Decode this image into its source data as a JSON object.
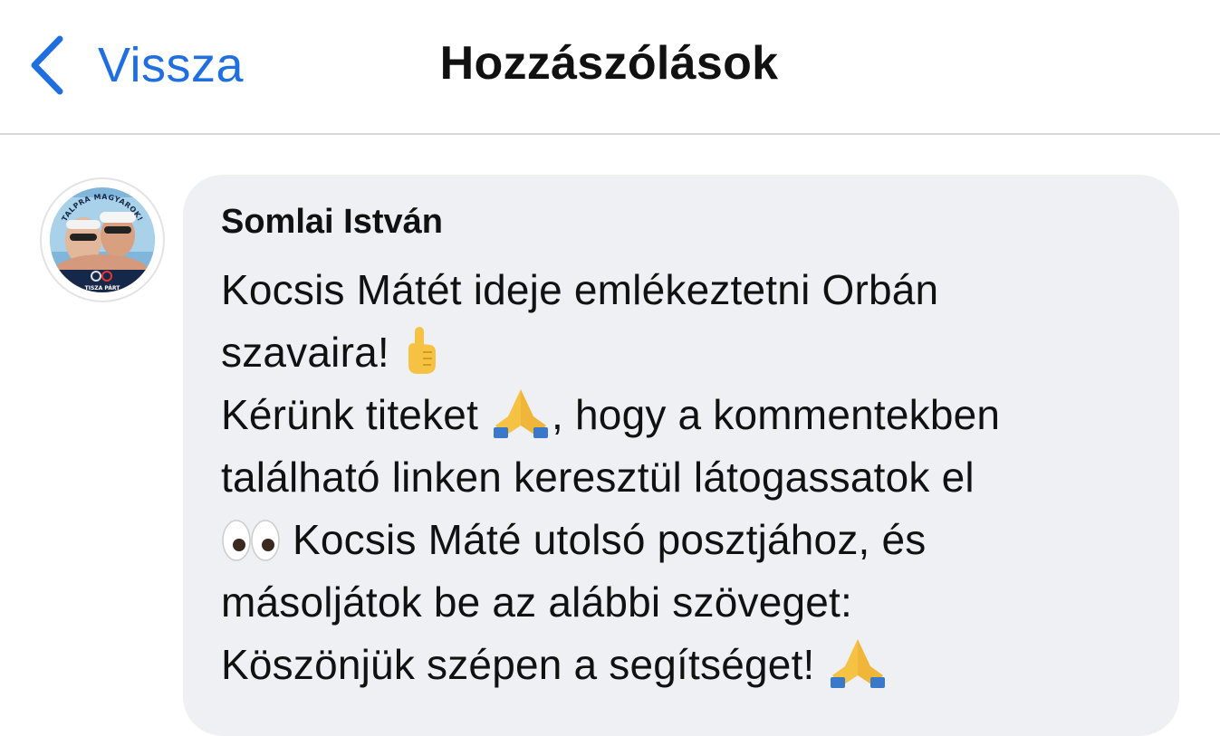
{
  "nav": {
    "back_label": "Vissza",
    "title": "Hozzászólások",
    "back_icon": "chevron-left-icon",
    "accent": "#1f6fe0"
  },
  "comment": {
    "author": "Somlai István",
    "avatar_text": {
      "top": "TALPRA MAGYAROK!",
      "bottom": "TISZA PÁRT"
    },
    "lines": [
      "Kocsis Mátét ideje emlékeztetni Orbán",
      "szavaira! ",
      "Kérünk titeket ",
      ", hogy a kommentekben",
      "található linken keresztül látogassatok el",
      " Kocsis Máté utolsó posztjához, és",
      "másoljátok be az alábbi szöveget:",
      "Köszönjük szépen a segítséget! "
    ],
    "emoji_icons": [
      "pointing-up-emoji",
      "folded-hands-emoji",
      "eyes-emoji",
      "folded-hands-emoji"
    ],
    "bubble_color": "#eef0f4"
  }
}
